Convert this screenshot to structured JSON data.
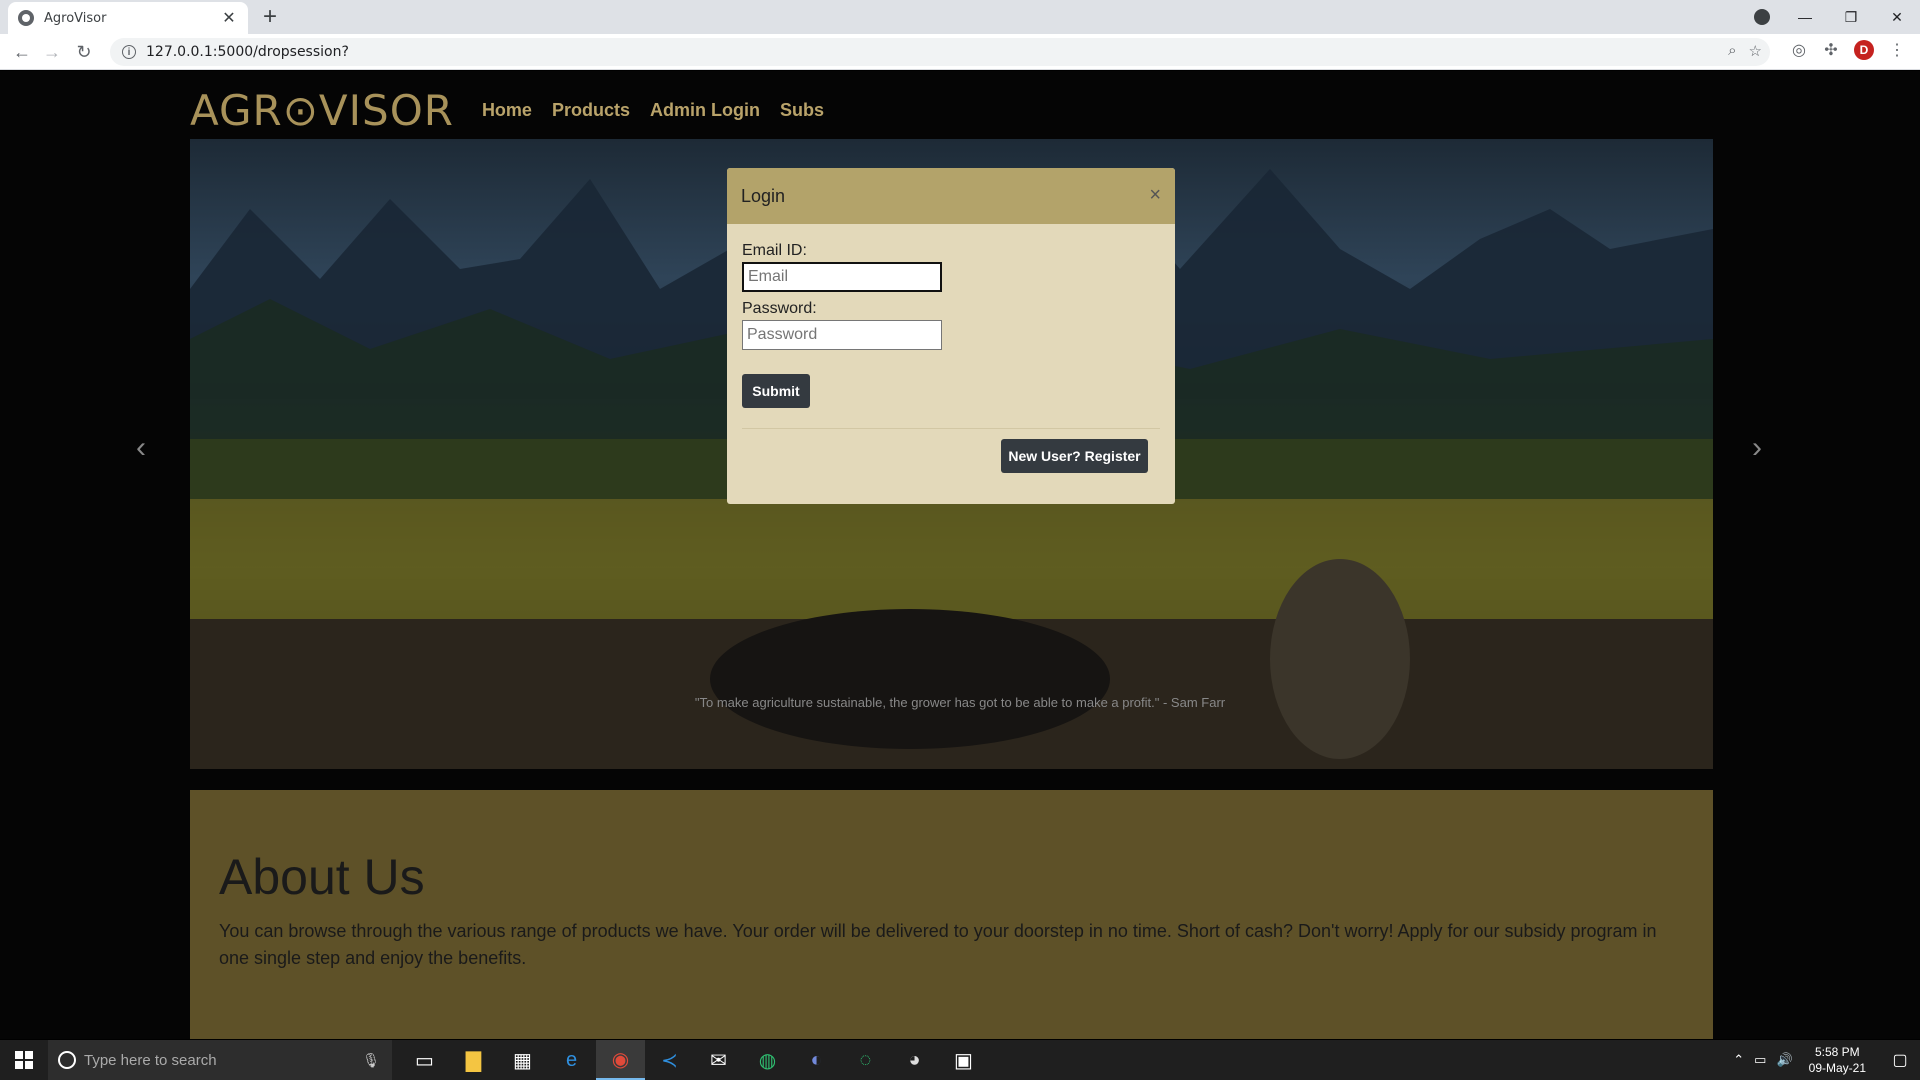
{
  "browser": {
    "tab_title": "AgroVisor",
    "url": "127.0.0.1:5000/dropsession?",
    "profile_initial": "D"
  },
  "site": {
    "logo": "AGR⊙VISOR",
    "nav": [
      "Home",
      "Products",
      "Admin Login",
      "Subs"
    ]
  },
  "carousel": {
    "caption": "\"To make agriculture sustainable, the grower has got to be able to make a profit.\" - Sam Farr"
  },
  "about": {
    "title": "About Us",
    "text": "You can browse through the various range of products we have. Your order will be delivered to your doorstep in no time. Short of cash? Don't worry! Apply for our subsidy program in one single step and enjoy the benefits."
  },
  "modal": {
    "title": "Login",
    "email_label": "Email ID:",
    "email_placeholder": "Email",
    "password_label": "Password:",
    "password_placeholder": "Password",
    "submit_label": "Submit",
    "register_label": "New User? Register"
  },
  "taskbar": {
    "search_placeholder": "Type here to search",
    "time": "5:58 PM",
    "date": "09-May-21"
  },
  "colors": {
    "modal_header": "#b3a36a",
    "modal_body": "#e3d9ba",
    "about_bg": "#5e5128",
    "nav_link": "#b9a36a",
    "button_dark": "#343a40"
  }
}
